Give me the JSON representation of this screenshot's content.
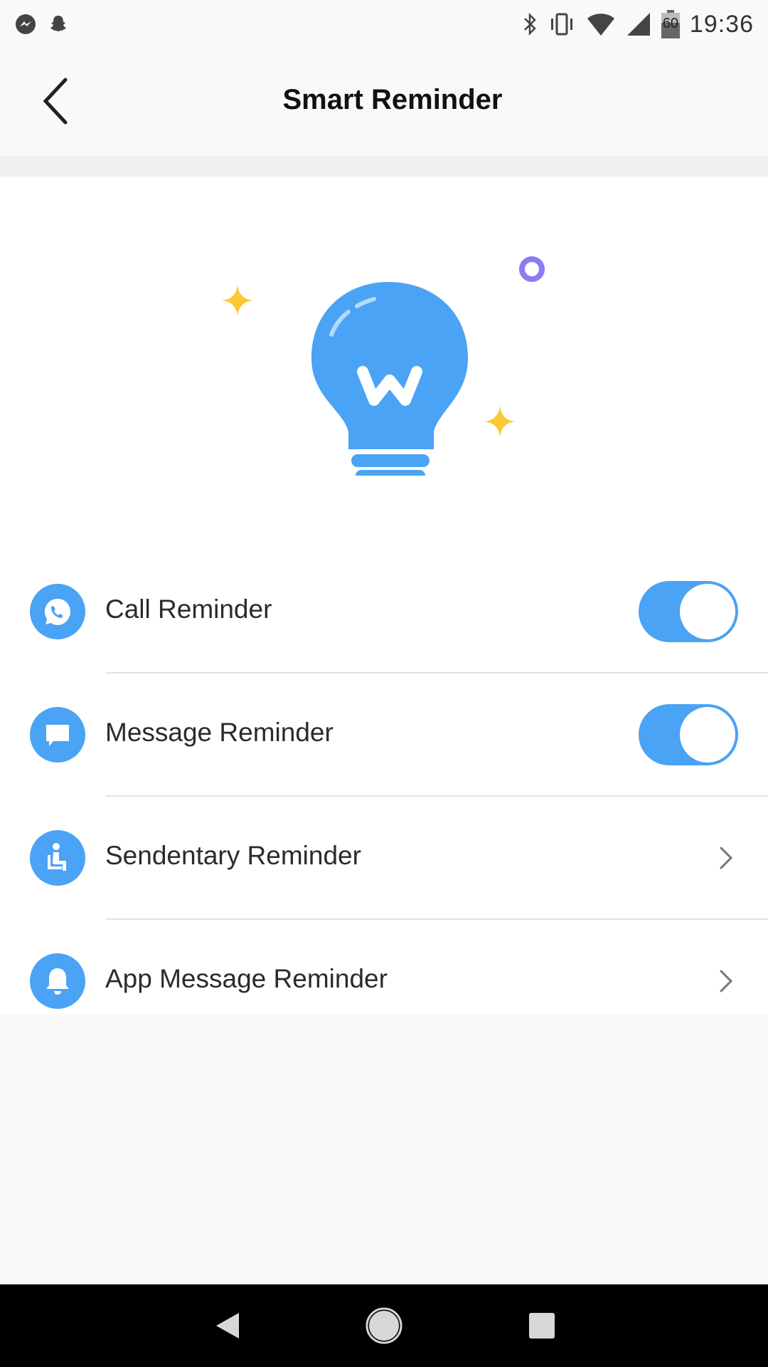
{
  "status_bar": {
    "time": "19:36",
    "battery_level": "60",
    "left_icons": [
      "messenger-icon",
      "snapchat-icon"
    ],
    "right_icons": [
      "bluetooth-icon",
      "vibrate-icon",
      "wifi-icon",
      "cellular-signal-icon",
      "battery-icon"
    ]
  },
  "header": {
    "title": "Smart Reminder",
    "back_icon": "back-arrow-icon"
  },
  "illustration": {
    "icon": "lightbulb-icon",
    "logo_letter": "w"
  },
  "settings": [
    {
      "label": "Call Reminder",
      "icon": "phone-icon",
      "control": "toggle",
      "enabled": true
    },
    {
      "label": "Message Reminder",
      "icon": "chat-bubble-icon",
      "control": "toggle",
      "enabled": true
    },
    {
      "label": "Sendentary Reminder",
      "icon": "seated-person-icon",
      "control": "chevron"
    },
    {
      "label": "App Message Reminder",
      "icon": "bell-icon",
      "control": "chevron"
    }
  ],
  "nav_bar": {
    "buttons": [
      "back-triangle-icon",
      "home-circle-icon",
      "recents-square-icon"
    ]
  },
  "colors": {
    "accent": "#4aa3f5",
    "star": "#fcc934",
    "ring": "#8a7cf2",
    "background": "#f9f9f9"
  }
}
